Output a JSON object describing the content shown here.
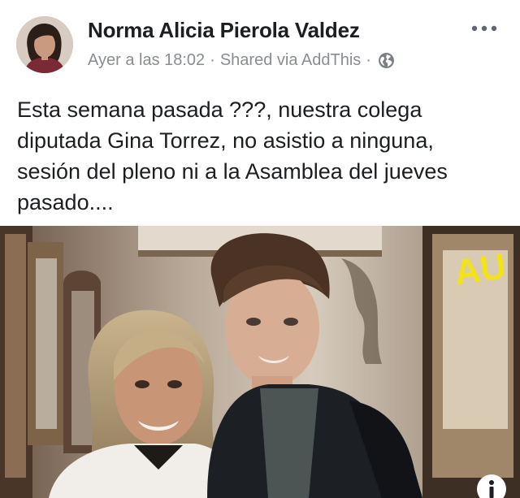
{
  "post": {
    "author_name": "Norma Alicia Pierola Valdez",
    "timestamp": "Ayer a las 18:02",
    "separator": "·",
    "shared_via": "Shared via AddThis",
    "audience_icon": "globe-icon",
    "more_icon": "more-options-icon",
    "text_lines": [
      "Esta semana pasada ???, nuestra colega",
      "diputada Gina Torrez, no asistio a ninguna,",
      "sesión del pleno ni a la Asamblea del jueves",
      "pasado...."
    ],
    "photo": {
      "sign_text": "AU",
      "info_icon": "info-icon"
    }
  },
  "colors": {
    "text": "#1c1e21",
    "meta": "#8a8d91",
    "sign_yellow": "#f2e21a"
  }
}
